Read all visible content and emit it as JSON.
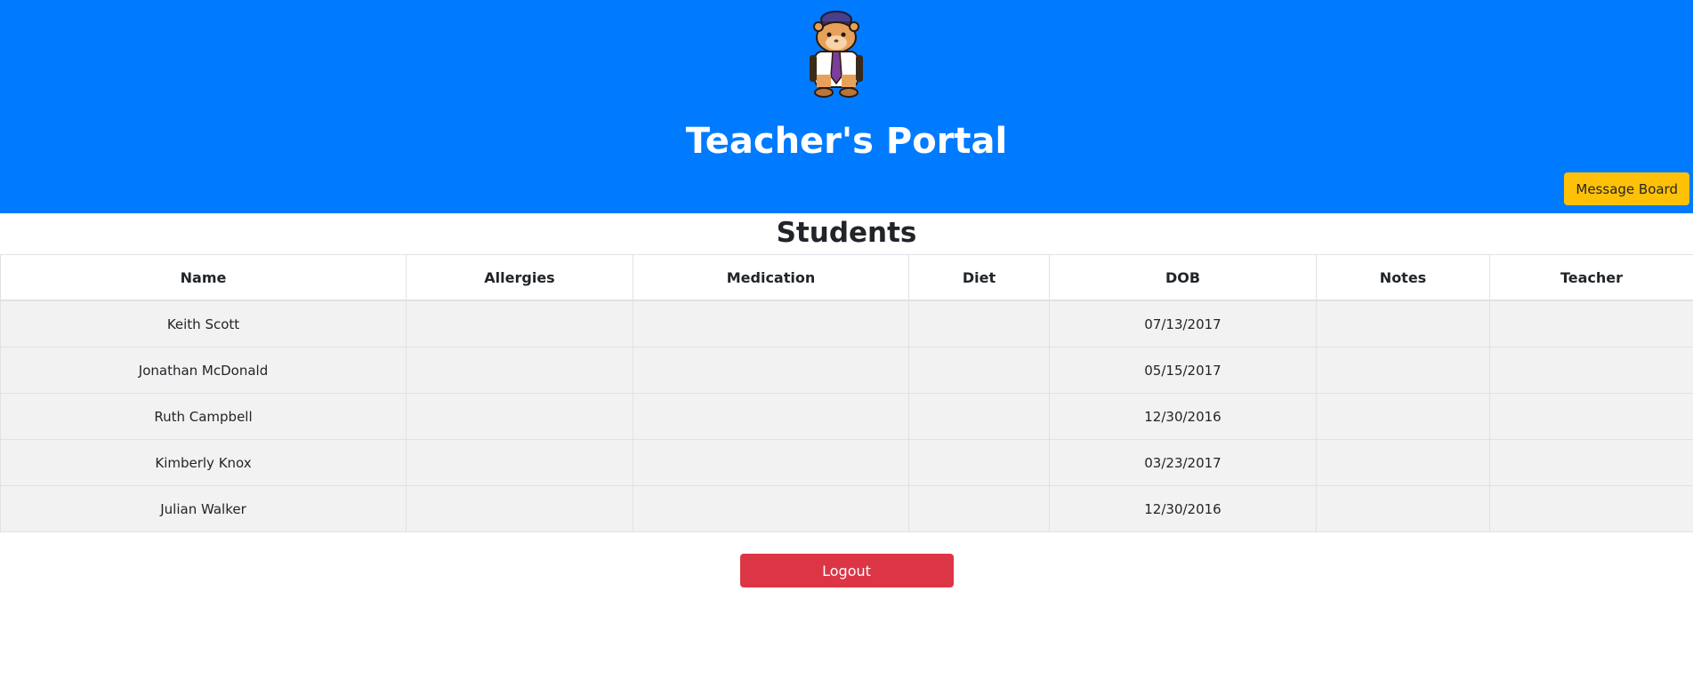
{
  "header": {
    "title": "Teacher's Portal",
    "message_board_label": "Message Board",
    "mascot_icon": "hamster-mascot-icon"
  },
  "students": {
    "heading": "Students",
    "columns": [
      "Name",
      "Allergies",
      "Medication",
      "Diet",
      "DOB",
      "Notes",
      "Teacher"
    ],
    "rows": [
      {
        "name": "Keith Scott",
        "allergies": "",
        "medication": "",
        "diet": "",
        "dob": "07/13/2017",
        "notes": "",
        "teacher": ""
      },
      {
        "name": "Jonathan McDonald",
        "allergies": "",
        "medication": "",
        "diet": "",
        "dob": "05/15/2017",
        "notes": "",
        "teacher": ""
      },
      {
        "name": "Ruth Campbell",
        "allergies": "",
        "medication": "",
        "diet": "",
        "dob": "12/30/2016",
        "notes": "",
        "teacher": ""
      },
      {
        "name": "Kimberly Knox",
        "allergies": "",
        "medication": "",
        "diet": "",
        "dob": "03/23/2017",
        "notes": "",
        "teacher": ""
      },
      {
        "name": "Julian Walker",
        "allergies": "",
        "medication": "",
        "diet": "",
        "dob": "12/30/2016",
        "notes": "",
        "teacher": ""
      }
    ]
  },
  "footer": {
    "logout_label": "Logout"
  },
  "colors": {
    "header_bg": "#007bff",
    "message_board_bg": "#ffc107",
    "logout_bg": "#dc3545",
    "row_bg": "#f2f2f2"
  }
}
